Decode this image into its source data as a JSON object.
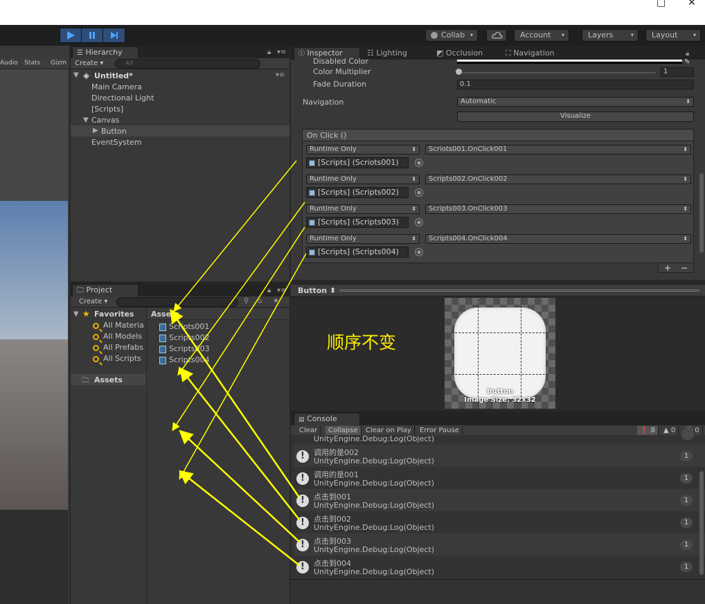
{
  "window": {
    "minimize_glyph": "□",
    "close_glyph": "✕"
  },
  "toolbar": {
    "play_icon": "play-icon",
    "pause_icon": "pause-icon",
    "step_icon": "step-icon",
    "collab": "Collab",
    "cloud_icon": "cloud-icon",
    "account": "Account",
    "layers": "Layers",
    "layout": "Layout"
  },
  "scene": {
    "tabs": [
      "Audio",
      "Stats",
      "Gizm"
    ]
  },
  "hierarchy": {
    "tab": "Hierarchy",
    "create": "Create",
    "search_placeholder": "All",
    "scene": "Untitled*",
    "items": [
      "Main Camera",
      "Directional Light",
      "[Scripts]",
      "Canvas",
      "Button",
      "EventSystem"
    ]
  },
  "inspector": {
    "tabs": [
      "Inspector",
      "Lighting",
      "Occlusion",
      "Navigation"
    ],
    "disabled_color_label": "Disabled Color",
    "color_multiplier_label": "Color Multiplier",
    "color_multiplier_value": "1",
    "fade_duration_label": "Fade Duration",
    "fade_duration_value": "0.1",
    "navigation_label": "Navigation",
    "navigation_value": "Automatic",
    "visualize": "Visualize",
    "onclick_header": "On Click ()",
    "events": [
      {
        "mode": "Runtime Only",
        "object": "[Scripts] (Scriots001)",
        "function": "Scriots001.OnClick001"
      },
      {
        "mode": "Runtime Only",
        "object": "[Scripts] (Scripts002)",
        "function": "Scripts002.OnClick002"
      },
      {
        "mode": "Runtime Only",
        "object": "[Scripts] (Scripts003)",
        "function": "Scripts003.OnClick003"
      },
      {
        "mode": "Runtime Only",
        "object": "[Scripts] (Scripts004)",
        "function": "Scripts004.OnClick004"
      }
    ],
    "plus": "+",
    "minus": "−"
  },
  "preview": {
    "title": "Button",
    "annotation": "顺序不变",
    "button_label": "Button",
    "image_size": "Image Size: 32x32"
  },
  "project": {
    "tab": "Project",
    "create": "Create",
    "favorites": "Favorites",
    "fav_items": [
      "All Materia",
      "All Models",
      "All Prefabs",
      "All Scripts"
    ],
    "assets_label": "Assets",
    "assets_header": "Assets",
    "files": [
      "Scriots001",
      "Scripts002",
      "Scripts003",
      "Scripts004"
    ]
  },
  "console": {
    "tab": "Console",
    "buttons": [
      "Clear",
      "Collapse",
      "Clear on Play",
      "Error Pause"
    ],
    "counts": {
      "info": "8",
      "warn": "0",
      "error": "0"
    },
    "partial_line": "UnityEngine.Debug:Log(Object)",
    "rows": [
      {
        "msg": "调用的是002",
        "trace": "UnityEngine.Debug:Log(Object)",
        "count": "1"
      },
      {
        "msg": "调用的是001",
        "trace": "UnityEngine.Debug:Log(Object)",
        "count": "1"
      },
      {
        "msg": "点击到001",
        "trace": "UnityEngine.Debug:Log(Object)",
        "count": "1"
      },
      {
        "msg": "点击到002",
        "trace": "UnityEngine.Debug:Log(Object)",
        "count": "1"
      },
      {
        "msg": "点击到003",
        "trace": "UnityEngine.Debug:Log(Object)",
        "count": "1"
      },
      {
        "msg": "点击到004",
        "trace": "UnityEngine.Debug:Log(Object)",
        "count": "1"
      }
    ]
  },
  "colors": {
    "arrow": "#ffff00",
    "annotation": "#ffee00",
    "play_bg": "#2e4d78"
  }
}
